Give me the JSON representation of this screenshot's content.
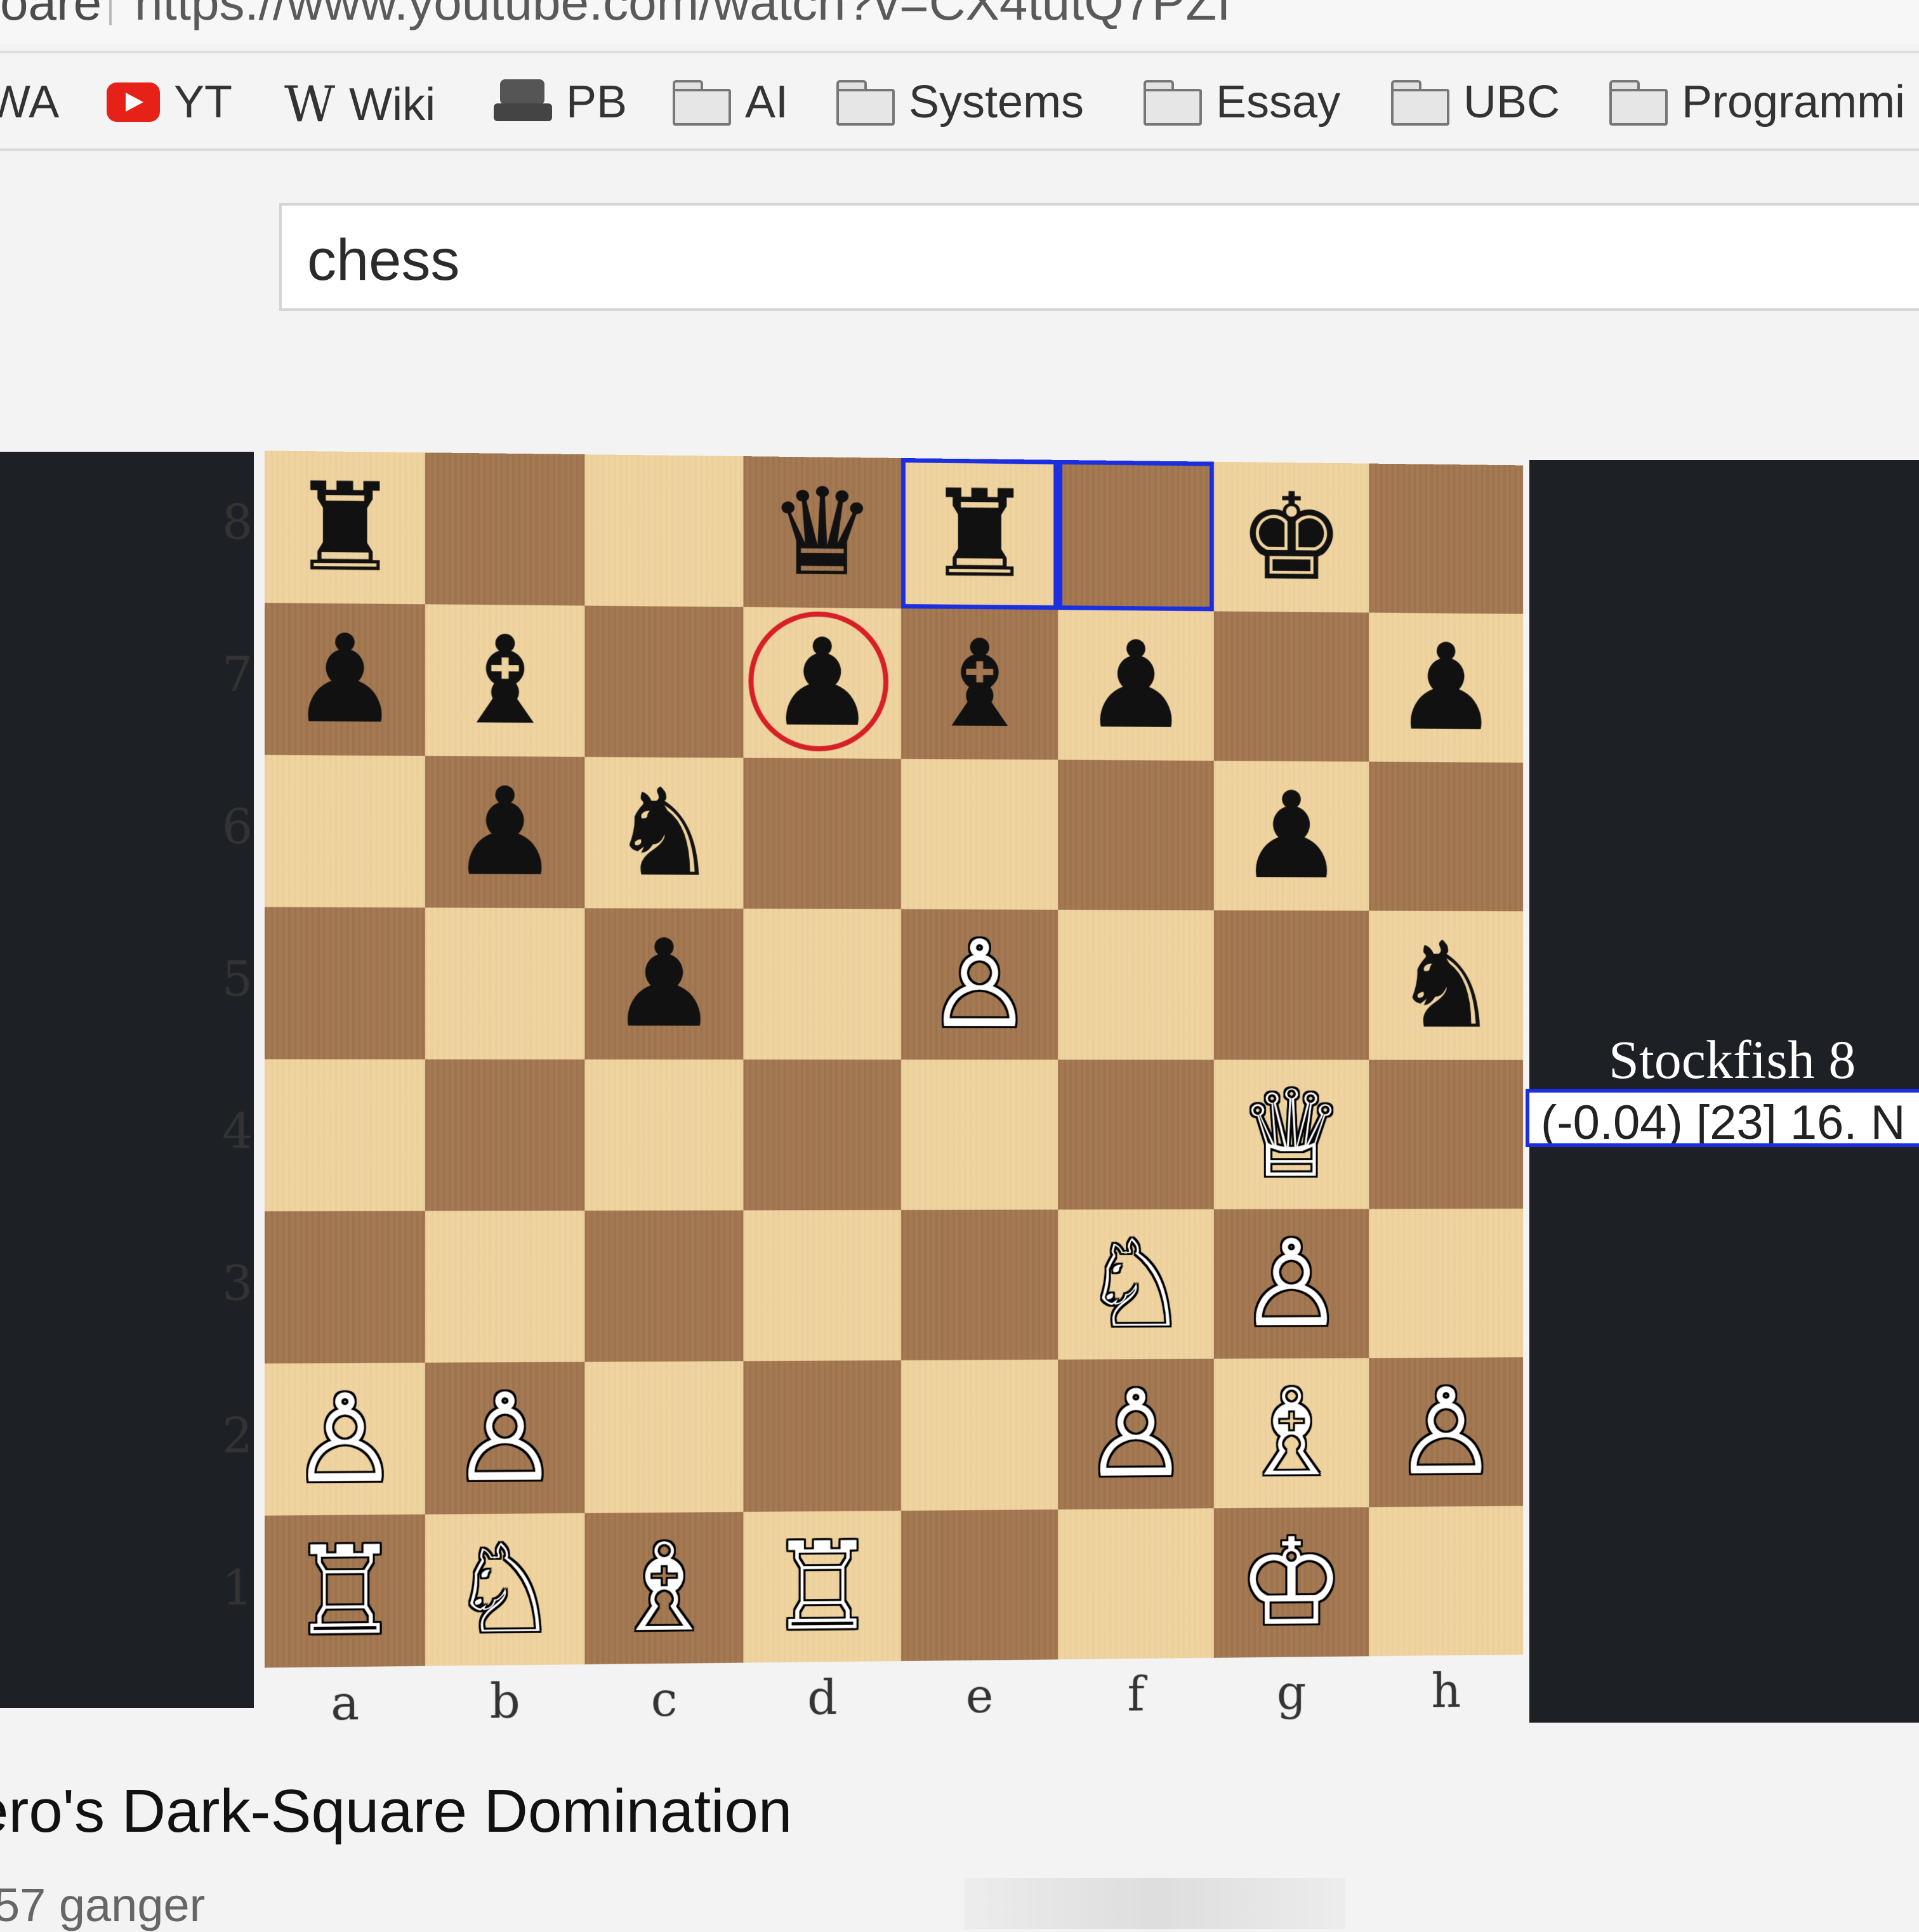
{
  "browser": {
    "url_fragment_left": "oare",
    "url": "https://www.youtube.com/watch?v=CX4tutQ7PZI"
  },
  "bookmarks": [
    {
      "label": "WA",
      "icon": "none"
    },
    {
      "label": "YT",
      "icon": "youtube-icon"
    },
    {
      "label": "Wiki",
      "icon": "wikipedia-icon"
    },
    {
      "label": "PB",
      "icon": "printer-icon"
    },
    {
      "label": "AI",
      "icon": "folder-icon"
    },
    {
      "label": "Systems",
      "icon": "folder-icon"
    },
    {
      "label": "Essay",
      "icon": "folder-icon"
    },
    {
      "label": "UBC",
      "icon": "folder-icon"
    },
    {
      "label": "Programmi",
      "icon": "folder-icon"
    }
  ],
  "search": {
    "value": "chess"
  },
  "board": {
    "ranks": [
      "8",
      "7",
      "6",
      "5",
      "4",
      "3",
      "2",
      "1"
    ],
    "files": [
      "a",
      "b",
      "c",
      "d",
      "e",
      "f",
      "g",
      "h"
    ],
    "pieces": [
      {
        "sq": "a8",
        "glyph": "♜",
        "color": "black"
      },
      {
        "sq": "d8",
        "glyph": "♛",
        "color": "black"
      },
      {
        "sq": "e8",
        "glyph": "♜",
        "color": "black"
      },
      {
        "sq": "g8",
        "glyph": "♚",
        "color": "black"
      },
      {
        "sq": "a7",
        "glyph": "♟",
        "color": "black"
      },
      {
        "sq": "b7",
        "glyph": "♝",
        "color": "black"
      },
      {
        "sq": "d7",
        "glyph": "♟",
        "color": "black"
      },
      {
        "sq": "e7",
        "glyph": "♝",
        "color": "black"
      },
      {
        "sq": "f7",
        "glyph": "♟",
        "color": "black"
      },
      {
        "sq": "h7",
        "glyph": "♟",
        "color": "black"
      },
      {
        "sq": "b6",
        "glyph": "♟",
        "color": "black"
      },
      {
        "sq": "c6",
        "glyph": "♞",
        "color": "black"
      },
      {
        "sq": "g6",
        "glyph": "♟",
        "color": "black"
      },
      {
        "sq": "c5",
        "glyph": "♟",
        "color": "black"
      },
      {
        "sq": "e5",
        "glyph": "♙",
        "color": "white"
      },
      {
        "sq": "h5",
        "glyph": "♞",
        "color": "black"
      },
      {
        "sq": "g4",
        "glyph": "♕",
        "color": "white"
      },
      {
        "sq": "f3",
        "glyph": "♘",
        "color": "white"
      },
      {
        "sq": "g3",
        "glyph": "♙",
        "color": "white"
      },
      {
        "sq": "a2",
        "glyph": "♙",
        "color": "white"
      },
      {
        "sq": "b2",
        "glyph": "♙",
        "color": "white"
      },
      {
        "sq": "f2",
        "glyph": "♙",
        "color": "white"
      },
      {
        "sq": "g2",
        "glyph": "♗",
        "color": "white"
      },
      {
        "sq": "h2",
        "glyph": "♙",
        "color": "white"
      },
      {
        "sq": "a1",
        "glyph": "♖",
        "color": "white"
      },
      {
        "sq": "b1",
        "glyph": "♘",
        "color": "white"
      },
      {
        "sq": "c1",
        "glyph": "♗",
        "color": "white"
      },
      {
        "sq": "d1",
        "glyph": "♖",
        "color": "white"
      },
      {
        "sq": "g1",
        "glyph": "♔",
        "color": "white"
      }
    ],
    "highlighted_squares": [
      "e8",
      "f8"
    ],
    "circled_square": "d7",
    "highlight_color": "#1b2fe0",
    "circle_color": "#d61f26"
  },
  "engine": {
    "name": "Stockfish 8",
    "line": "(-0.04) [23]  16. N"
  },
  "video": {
    "title": "ero's Dark-Square Domination",
    "meta": "57 ganger"
  }
}
